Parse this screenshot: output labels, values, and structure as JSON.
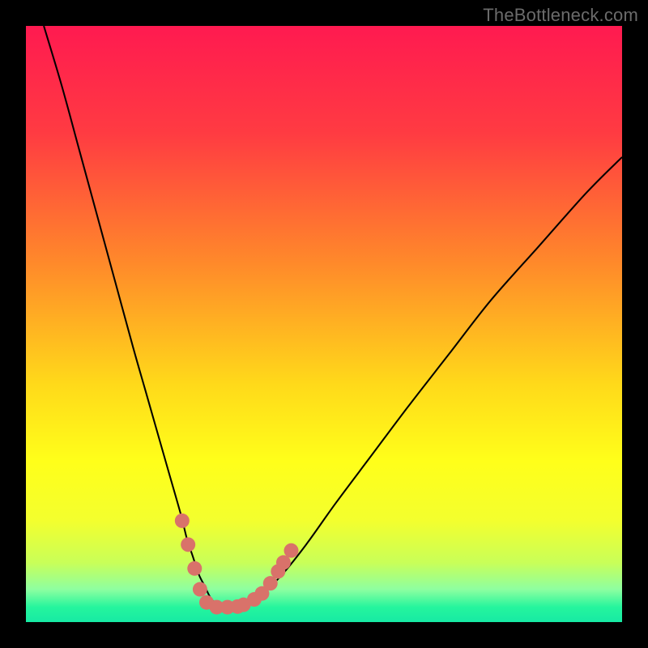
{
  "watermark": "TheBottleneck.com",
  "chart_data": {
    "type": "line",
    "title": "",
    "xlabel": "",
    "ylabel": "",
    "xlim": [
      0,
      100
    ],
    "ylim": [
      0,
      100
    ],
    "annotations": [],
    "legend": [],
    "background_gradient_stops": [
      {
        "offset": 0.0,
        "color": "#ff1a50"
      },
      {
        "offset": 0.18,
        "color": "#ff3b42"
      },
      {
        "offset": 0.4,
        "color": "#ff8a2a"
      },
      {
        "offset": 0.6,
        "color": "#ffd91a"
      },
      {
        "offset": 0.73,
        "color": "#ffff1a"
      },
      {
        "offset": 0.83,
        "color": "#f3ff2e"
      },
      {
        "offset": 0.9,
        "color": "#c9ff58"
      },
      {
        "offset": 0.945,
        "color": "#8effa0"
      },
      {
        "offset": 0.975,
        "color": "#25f59d"
      },
      {
        "offset": 1.0,
        "color": "#17eaa4"
      }
    ],
    "series": [
      {
        "name": "bottleneck-curve",
        "color": "#000000",
        "x": [
          3,
          6,
          9,
          12,
          15,
          18,
          20,
          22,
          24,
          26,
          27,
          28,
          29,
          30,
          31,
          32,
          33,
          34,
          36,
          38,
          40,
          43,
          47,
          52,
          58,
          64,
          71,
          78,
          86,
          94,
          100
        ],
        "y": [
          100,
          90,
          79,
          68,
          57,
          46,
          39,
          32,
          25,
          18,
          14,
          11,
          8,
          6,
          4,
          3,
          2.5,
          2.5,
          2.7,
          3.5,
          5,
          8,
          13,
          20,
          28,
          36,
          45,
          54,
          63,
          72,
          78
        ]
      }
    ],
    "markers": {
      "name": "highlight-dots",
      "color": "#d9726a",
      "radius": 9,
      "points": [
        {
          "x": 26.2,
          "y": 17
        },
        {
          "x": 27.2,
          "y": 13
        },
        {
          "x": 28.3,
          "y": 9
        },
        {
          "x": 29.2,
          "y": 5.5
        },
        {
          "x": 30.3,
          "y": 3.3
        },
        {
          "x": 32.0,
          "y": 2.5
        },
        {
          "x": 33.8,
          "y": 2.5
        },
        {
          "x": 35.5,
          "y": 2.6
        },
        {
          "x": 36.5,
          "y": 2.9
        },
        {
          "x": 38.3,
          "y": 3.8
        },
        {
          "x": 39.6,
          "y": 4.8
        },
        {
          "x": 41.0,
          "y": 6.5
        },
        {
          "x": 42.3,
          "y": 8.5
        },
        {
          "x": 43.2,
          "y": 10.0
        },
        {
          "x": 44.5,
          "y": 12.0
        }
      ]
    }
  }
}
